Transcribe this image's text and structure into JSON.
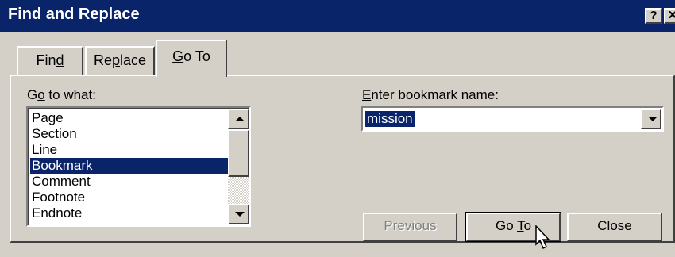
{
  "window": {
    "title": "Find and Replace",
    "help_button": "?",
    "close_button": "✕"
  },
  "tabs": [
    {
      "pre": "Fin",
      "key": "d",
      "post": ""
    },
    {
      "pre": "Re",
      "key": "p",
      "post": "lace"
    },
    {
      "pre": "",
      "key": "G",
      "post": "o To"
    }
  ],
  "goto_label": {
    "pre": "G",
    "key": "o",
    "post": " to what:"
  },
  "bookmark_label": {
    "pre": "",
    "key": "E",
    "post": "nter bookmark name:"
  },
  "list": {
    "items": [
      "Page",
      "Section",
      "Line",
      "Bookmark",
      "Comment",
      "Footnote",
      "Endnote"
    ],
    "selected": "Bookmark"
  },
  "bookmark_input": {
    "value": "mission"
  },
  "buttons": {
    "previous": "Previous",
    "goto": {
      "pre": "Go ",
      "key": "T",
      "post": "o"
    },
    "close": "Close"
  },
  "colors": {
    "titlebar": "#0a246a",
    "face": "#d4d0c8",
    "selection": "#0a246a"
  }
}
